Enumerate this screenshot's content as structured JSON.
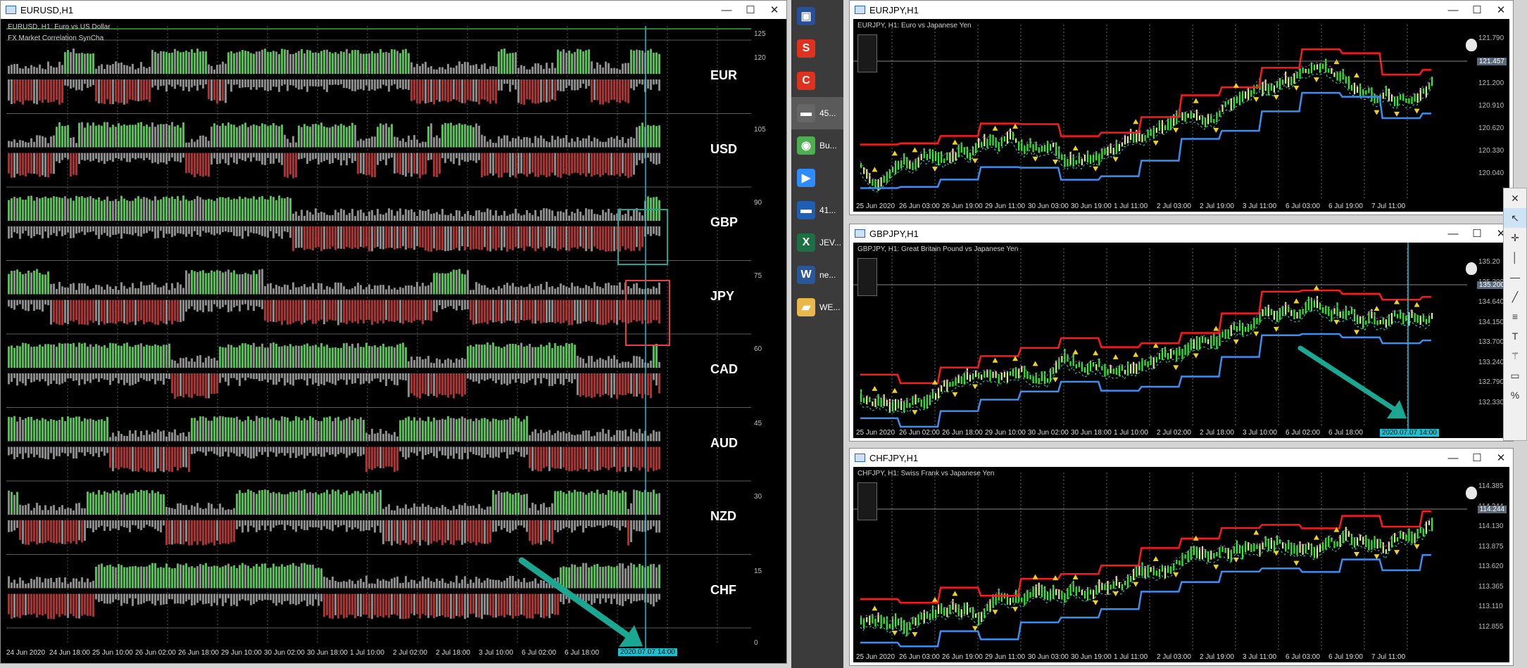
{
  "left_window": {
    "title": "EURUSD,H1",
    "symbol_line": "EURUSD, H1: Euro vs US Dollar",
    "indicator_name": "FX Market Correlation SynCha",
    "currencies": [
      "EUR",
      "USD",
      "GBP",
      "JPY",
      "CAD",
      "AUD",
      "NZD",
      "CHF"
    ],
    "price_scale": [
      "125",
      "120",
      "105",
      "90",
      "75",
      "60",
      "45",
      "30",
      "15",
      "0"
    ],
    "time_labels": [
      "24 Jun 2020",
      "24 Jun 18:00",
      "25 Jun 10:00",
      "26 Jun 02:00",
      "26 Jun 18:00",
      "29 Jun 10:00",
      "30 Jun 02:00",
      "30 Jun 18:00",
      "1 Jul 10:00",
      "2 Jul 02:00",
      "2 Jul 18:00",
      "3 Jul 10:00",
      "6 Jul 02:00",
      "6 Jul 18:00"
    ],
    "current_time": "2020.07.07 14:00"
  },
  "taskbar": {
    "items": [
      {
        "label": "",
        "icon": "computer-icon",
        "color": "#2a4f9a"
      },
      {
        "label": "",
        "icon": "s-icon",
        "color": "#e0301e"
      },
      {
        "label": "",
        "icon": "c-icon",
        "color": "#e0301e"
      },
      {
        "label": "45...",
        "icon": "app-icon",
        "color": "#666666"
      },
      {
        "label": "Bu...",
        "icon": "chrome-icon",
        "color": "#4caf50"
      },
      {
        "label": "",
        "icon": "zoom-icon",
        "color": "#2d8cff"
      },
      {
        "label": "41...",
        "icon": "app-icon",
        "color": "#1e5fb3"
      },
      {
        "label": "JEV...",
        "icon": "excel-icon",
        "color": "#1d7044"
      },
      {
        "label": "ne...",
        "icon": "word-icon",
        "color": "#2b579a"
      },
      {
        "label": "WE...",
        "icon": "folder-icon",
        "color": "#e8b84a"
      }
    ]
  },
  "right_windows": [
    {
      "title": "EURJPY,H1",
      "symbol_line": "EURJPY, H1: Euro vs Japanese Yen",
      "price_scale": [
        "121.790",
        "121.457",
        "121.200",
        "120.910",
        "120.620",
        "120.330",
        "120.040"
      ],
      "current_price": "121.457",
      "time_labels": [
        "25 Jun 2020",
        "26 Jun 03:00",
        "26 Jun 19:00",
        "29 Jun 11:00",
        "30 Jun 03:00",
        "30 Jun 19:00",
        "1 Jul 11:00",
        "2 Jul 03:00",
        "2 Jul 19:00",
        "3 Jul 11:00",
        "6 Jul 03:00",
        "6 Jul 19:00",
        "7 Jul 11:00"
      ],
      "current_time": ""
    },
    {
      "title": "GBPJPY,H1",
      "symbol_line": "GBPJPY, H1: Great Britain Pound vs Japanese Yen",
      "price_scale": [
        "135.20",
        "135.200",
        "134.640",
        "134.150",
        "133.700",
        "133.240",
        "132.790",
        "132.330"
      ],
      "current_price": "135.200",
      "time_labels": [
        "25 Jun 2020",
        "26 Jun 02:00",
        "26 Jun 18:00",
        "29 Jun 10:00",
        "30 Jun 02:00",
        "30 Jun 18:00",
        "1 Jul 10:00",
        "2 Jul 02:00",
        "2 Jul 18:00",
        "3 Jul 10:00",
        "6 Jul 02:00",
        "6 Jul 18:00"
      ],
      "current_time": "2020.07.07 14:00"
    },
    {
      "title": "CHFJPY,H1",
      "symbol_line": "CHFJPY, H1: Swiss Frank vs Japanese Yen",
      "price_scale": [
        "114.385",
        "114.244",
        "114.130",
        "113.875",
        "113.620",
        "113.365",
        "113.110",
        "112.855"
      ],
      "current_price": "114.244",
      "time_labels": [
        "25 Jun 2020",
        "26 Jun 03:00",
        "26 Jun 19:00",
        "29 Jun 11:00",
        "30 Jun 03:00",
        "30 Jun 19:00",
        "1 Jul 11:00",
        "2 Jul 03:00",
        "2 Jul 19:00",
        "3 Jul 11:00",
        "6 Jul 03:00",
        "6 Jul 19:00",
        "7 Jul 11:00"
      ],
      "current_time": ""
    }
  ],
  "colors": {
    "bull": "#33d433",
    "bear": "#d42020",
    "neutral": "#8a8a8a",
    "cursor": "#19c3d2",
    "arrow": "#1aa893",
    "sup": "#3a8ff0",
    "res": "#ff1a1a"
  }
}
